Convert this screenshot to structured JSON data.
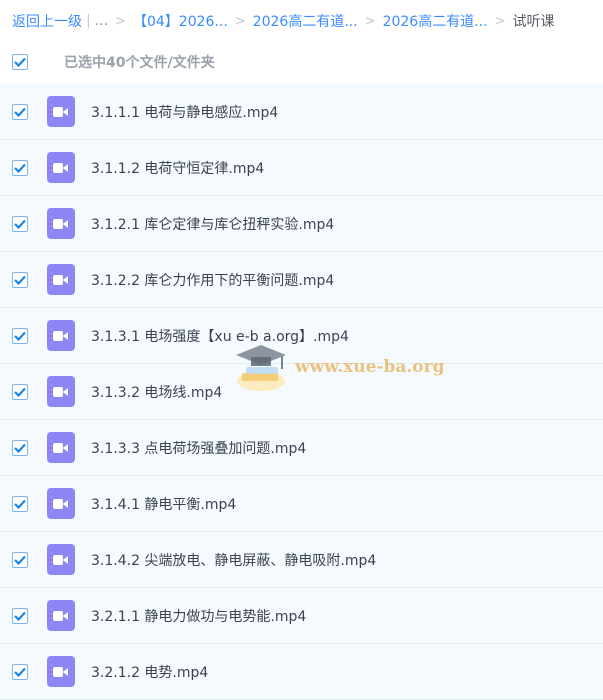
{
  "breadcrumb": {
    "back": "返回上一级",
    "ellipsis": "...",
    "crumbs": [
      "【04】2026...",
      "2026高二有道...",
      "2026高二有道..."
    ],
    "current": "试听课"
  },
  "selection": {
    "status": "已选中40个文件/文件夹",
    "all_checked": true
  },
  "files": [
    {
      "name": "3.1.1.1 电荷与静电感应.mp4",
      "icon": "video-file-icon"
    },
    {
      "name": "3.1.1.2 电荷守恒定律.mp4",
      "icon": "video-file-icon"
    },
    {
      "name": "3.1.2.1 库仑定律与库仑扭秤实验.mp4",
      "icon": "video-file-icon"
    },
    {
      "name": "3.1.2.2 库仑力作用下的平衡问题.mp4",
      "icon": "video-file-icon"
    },
    {
      "name": "3.1.3.1 电场强度【xu e-b a.org】.mp4",
      "icon": "video-file-icon"
    },
    {
      "name": "3.1.3.2 电场线.mp4",
      "icon": "video-file-icon"
    },
    {
      "name": "3.1.3.3 点电荷场强叠加问题.mp4",
      "icon": "video-file-icon"
    },
    {
      "name": "3.1.4.1 静电平衡.mp4",
      "icon": "video-file-icon"
    },
    {
      "name": "3.1.4.2 尖端放电、静电屏蔽、静电吸附.mp4",
      "icon": "video-file-icon"
    },
    {
      "name": "3.2.1.1 静电力做功与电势能.mp4",
      "icon": "video-file-icon"
    },
    {
      "name": "3.2.1.2 电势.mp4",
      "icon": "video-file-icon"
    }
  ],
  "watermark": {
    "text": "www.xue-ba.org",
    "icon": "graduation-cap-icon"
  },
  "colors": {
    "link": "#3b8cff",
    "checkbox": "#1a84e8",
    "row_background": "#f5faff",
    "video_icon": "#8f86f5"
  }
}
